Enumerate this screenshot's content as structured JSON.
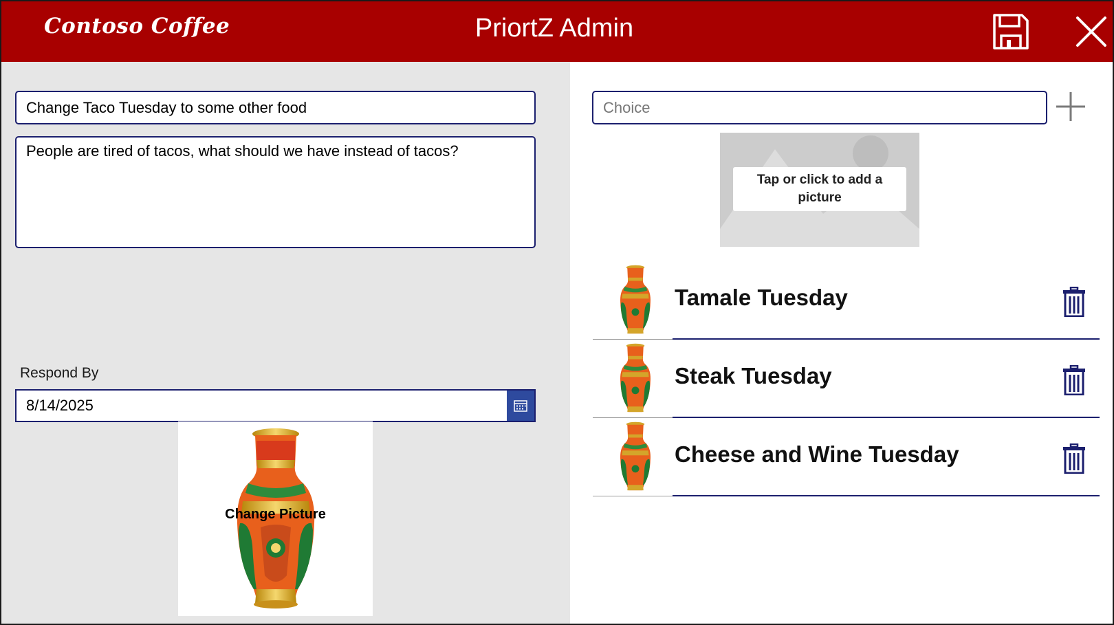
{
  "header": {
    "brand": "Contoso Coffee",
    "title": "PriortZ Admin",
    "save_icon": "floppy-disk-icon",
    "close_icon": "close-icon",
    "background_color": "#a80000"
  },
  "form": {
    "title_value": "Change Taco Tuesday to some other food",
    "description_value": "People are tired of tacos, what should we have instead of tacos?",
    "respond_by_label": "Respond By",
    "respond_by_value": "8/14/2025",
    "calendar_icon": "calendar-icon",
    "change_picture_label": "Change Picture"
  },
  "choices": {
    "input_placeholder": "Choice",
    "add_icon": "plus-icon",
    "add_picture_label": "Tap or click to add a picture",
    "items": [
      {
        "label": "Tamale Tuesday"
      },
      {
        "label": "Steak Tuesday"
      },
      {
        "label": "Cheese and Wine Tuesday"
      }
    ],
    "delete_icon": "trash-icon"
  },
  "colors": {
    "accent": "#1b1f6e",
    "left_panel_bg": "#e6e6e6",
    "calendar_button": "#2e4a9e"
  }
}
